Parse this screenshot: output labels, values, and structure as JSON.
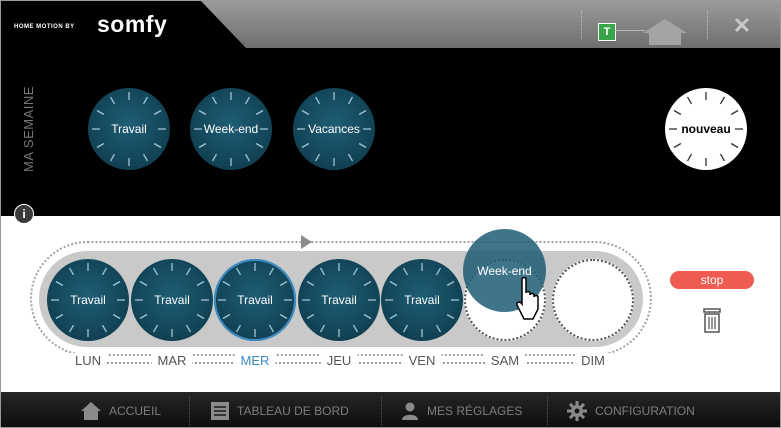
{
  "header": {
    "brand_prefix": "HOME MOTION BY",
    "brand": "somfy",
    "t_button": "T",
    "close": "✕"
  },
  "week_panel": {
    "title": "MA SEMAINE",
    "templates": [
      {
        "label": "Travail"
      },
      {
        "label": "Week-end"
      },
      {
        "label": "Vacances"
      }
    ],
    "new_label": "nouveau"
  },
  "info_icon": "i",
  "timeline": {
    "days": [
      {
        "name": "LUN",
        "program": "Travail",
        "active": false
      },
      {
        "name": "MAR",
        "program": "Travail",
        "active": false
      },
      {
        "name": "MER",
        "program": "Travail",
        "active": true
      },
      {
        "name": "JEU",
        "program": "Travail",
        "active": false
      },
      {
        "name": "VEN",
        "program": "Travail",
        "active": false
      },
      {
        "name": "SAM",
        "program": "",
        "active": false
      },
      {
        "name": "DIM",
        "program": "",
        "active": false
      }
    ],
    "dragging_label": "Week-end"
  },
  "actions": {
    "stop_label": "stop"
  },
  "nav": {
    "items": [
      {
        "label": "ACCUEIL",
        "icon": "home-icon"
      },
      {
        "label": "TABLEAU DE BORD",
        "icon": "dashboard-icon"
      },
      {
        "label": "MES RÉGLAGES",
        "icon": "user-icon"
      },
      {
        "label": "CONFIGURATION",
        "icon": "gear-icon"
      }
    ]
  },
  "colors": {
    "dial_dark": "#14485c",
    "active_day": "#3b8bc2",
    "stop": "#ee5b52",
    "t_button": "#3aa44a"
  }
}
